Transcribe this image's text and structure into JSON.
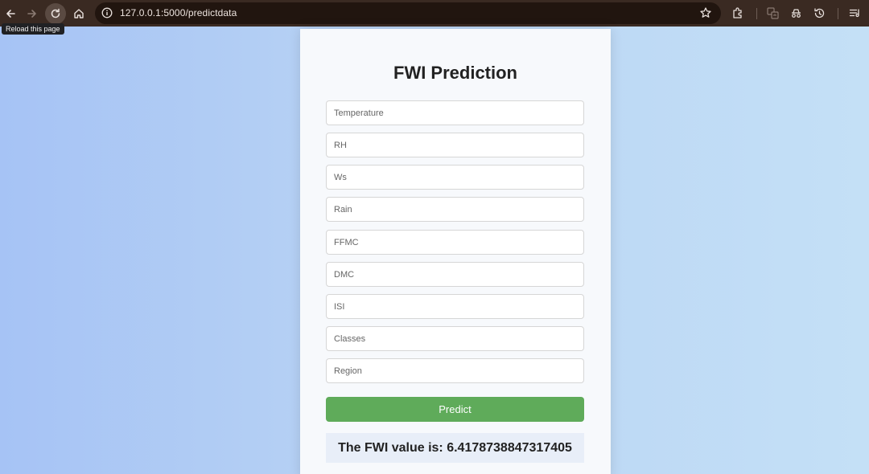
{
  "browser": {
    "url": "127.0.0.1:5000/predictdata",
    "tooltip": "Reload this page",
    "colors": {
      "toolbar": "#3a2a22",
      "omnibox": "#21150f"
    }
  },
  "form": {
    "title": "FWI Prediction",
    "fields": [
      {
        "placeholder": "Temperature"
      },
      {
        "placeholder": "RH"
      },
      {
        "placeholder": "Ws"
      },
      {
        "placeholder": "Rain"
      },
      {
        "placeholder": "FFMC"
      },
      {
        "placeholder": "DMC"
      },
      {
        "placeholder": "ISI"
      },
      {
        "placeholder": "Classes"
      },
      {
        "placeholder": "Region"
      }
    ],
    "submit_label": "Predict",
    "result_text": "The FWI value is: 6.4178738847317405",
    "colors": {
      "button": "#5fab5a",
      "result_bg": "#e8eef8"
    }
  }
}
